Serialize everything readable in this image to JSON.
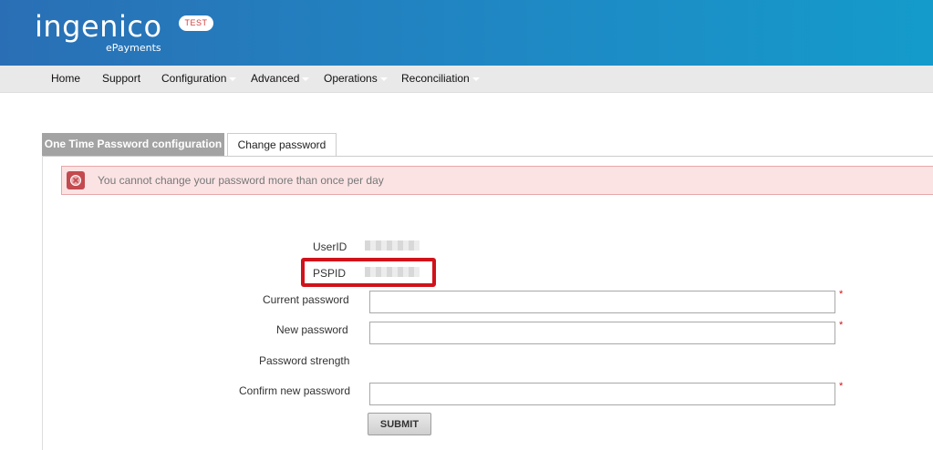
{
  "header": {
    "logo_text": "ingenico",
    "logo_sub": "ePayments",
    "env_badge": "TEST"
  },
  "nav": {
    "items": [
      {
        "label": "Home"
      },
      {
        "label": "Support"
      },
      {
        "label": "Configuration"
      },
      {
        "label": "Advanced"
      },
      {
        "label": "Operations"
      },
      {
        "label": "Reconciliation"
      }
    ]
  },
  "tabs": [
    {
      "label": "One Time Password configuration",
      "active": false
    },
    {
      "label": "Change password",
      "active": true
    }
  ],
  "alert": {
    "message": "You cannot change your password more than once per day"
  },
  "form": {
    "userid_label": "UserID",
    "pspid_label": "PSPID",
    "current_password_label": "Current password",
    "current_password_value": "",
    "new_password_label": "New password",
    "new_password_value": "",
    "password_strength_label": "Password strength",
    "confirm_password_label": "Confirm new password",
    "confirm_password_value": "",
    "required_marker": "*",
    "submit_label": "SUBMIT"
  },
  "colors": {
    "header_blue": "#1f88c4",
    "alert_background": "#fbe3e4",
    "highlight_red": "#d0121a",
    "inactive_tab": "#a3a3a3"
  }
}
